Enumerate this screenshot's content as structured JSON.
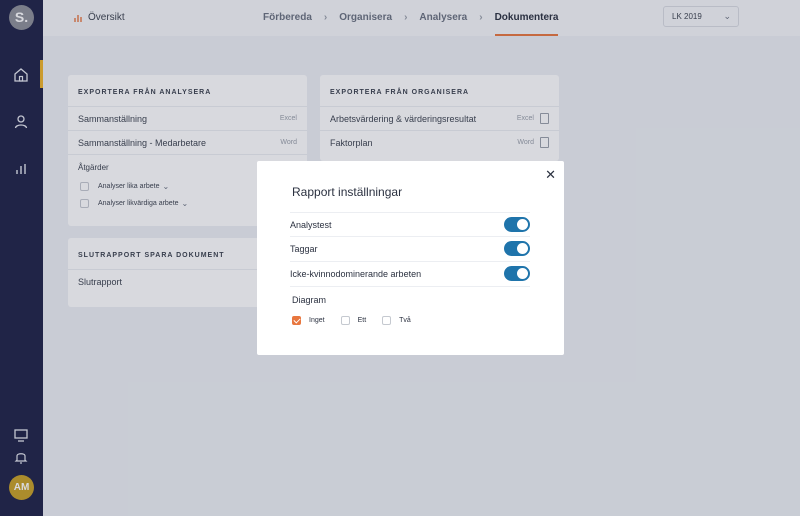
{
  "sidebar": {
    "logo": "S.",
    "avatar": "AM",
    "icons": [
      "home-icon",
      "user-icon",
      "bar-chart-icon",
      "monitor-icon",
      "bell-icon"
    ],
    "accent": "#f0b429"
  },
  "topbar": {
    "overview_label": "Översikt",
    "steps": [
      "Förbereda",
      "Organisera",
      "Analysera",
      "Dokumentera"
    ],
    "active_step": "Dokumentera",
    "year_select": "LK 2019"
  },
  "export_analysera": {
    "title": "EXPORTERA FRÅN ANALYSERA",
    "rows": [
      {
        "label": "Sammanställning",
        "type": "Excel"
      },
      {
        "label": "Sammanställning - Medarbetare",
        "type": "Word"
      }
    ],
    "actions_label": "Åtgärder",
    "actions": [
      "Analyser lika arbete",
      "Analyser likvärdiga arbete"
    ]
  },
  "export_organisera": {
    "title": "EXPORTERA FRÅN ORGANISERA",
    "rows": [
      {
        "label": "Arbetsvärdering & värderingsresultat",
        "type": "Excel"
      },
      {
        "label": "Faktorplan",
        "type": "Word"
      }
    ]
  },
  "slutrapport": {
    "title": "SLUTRAPPORT SPARA DOKUMENT",
    "rows": [
      {
        "label": "Slutrapport"
      }
    ]
  },
  "modal": {
    "title": "Rapport inställningar",
    "toggles": [
      {
        "label": "Analystest",
        "on": true
      },
      {
        "label": "Taggar",
        "on": true
      },
      {
        "label": "Icke-kvinnodominerande arbeten",
        "on": true
      }
    ],
    "diagram_label": "Diagram",
    "diagram_options": [
      {
        "label": "Inget",
        "checked": true
      },
      {
        "label": "Ett",
        "checked": false
      },
      {
        "label": "Två",
        "checked": false
      }
    ],
    "toggle_color": "#1f74ab",
    "check_color": "#e8773f"
  }
}
